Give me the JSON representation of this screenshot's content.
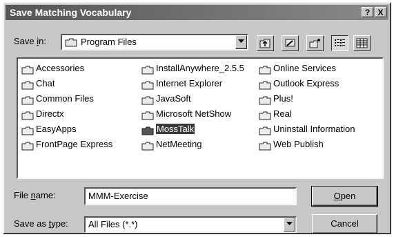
{
  "dialog": {
    "title": "Save Matching Vocabulary",
    "help_btn": "?",
    "close_btn": "X"
  },
  "save_in": {
    "label_pre": "Save ",
    "label_key": "i",
    "label_post": "n:",
    "value": "Program Files"
  },
  "toolbar": {
    "buttons": [
      "up-one-level-icon",
      "desktop-icon",
      "new-folder-icon",
      "list-view-icon",
      "details-view-icon"
    ]
  },
  "folders": {
    "col1": [
      "Accessories",
      "Chat",
      "Common Files",
      "Directx",
      "EasyApps",
      "FrontPage Express"
    ],
    "col2": [
      "InstallAnywhere_2.5.5",
      "Internet Explorer",
      "JavaSoft",
      "Microsoft NetShow",
      "MossTalk",
      "NetMeeting"
    ],
    "col3": [
      "Online Services",
      "Outlook Express",
      "Plus!",
      "Real",
      "Uninstall Information",
      "Web Publish"
    ],
    "selected": "MossTalk"
  },
  "file_name": {
    "label_pre": "File ",
    "label_key": "n",
    "label_post": "ame:",
    "value": "MMM-Exercise"
  },
  "save_type": {
    "label_pre": "Save as ",
    "label_key": "t",
    "label_post": "ype:",
    "value": "All Files (*.*)"
  },
  "buttons": {
    "open_key": "O",
    "open_rest": "pen",
    "cancel": "Cancel"
  },
  "colors": {
    "face": "#c8c8c8",
    "title_start": "#555555",
    "title_end": "#8a8a8a",
    "selection": "#3a3a3a"
  }
}
